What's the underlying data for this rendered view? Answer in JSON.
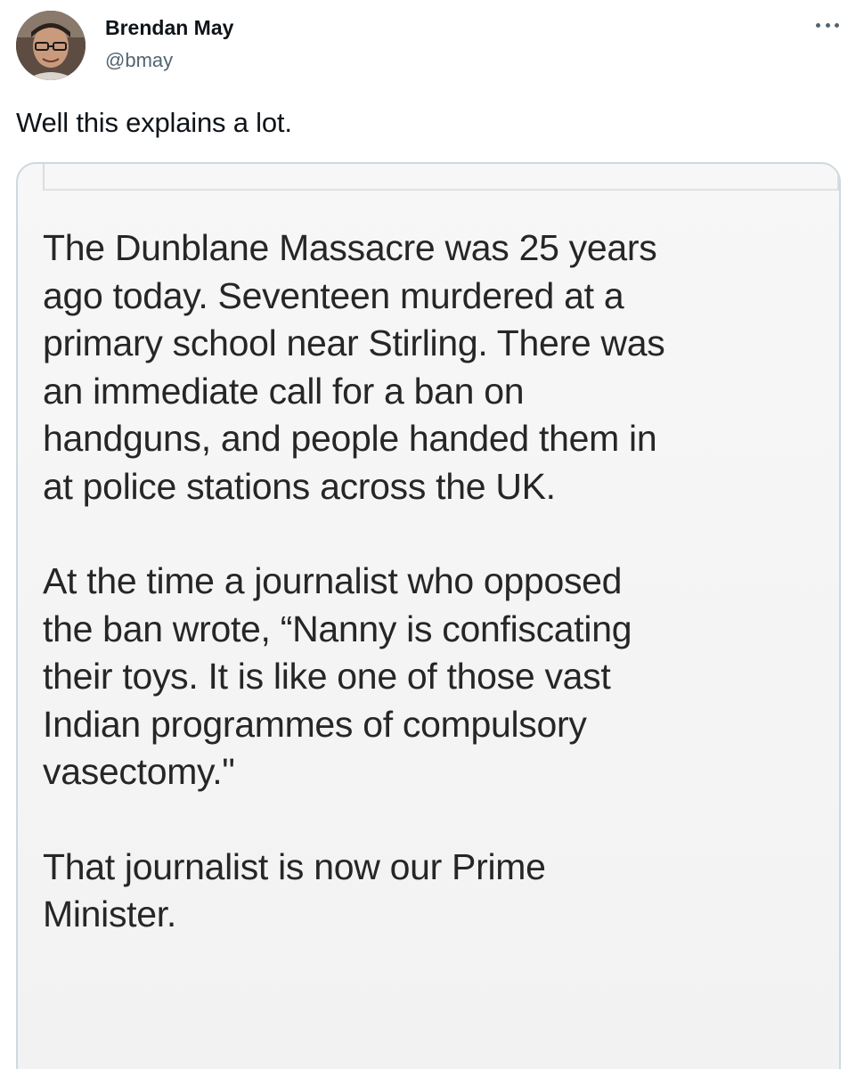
{
  "tweet": {
    "author": {
      "display_name": "Brendan May",
      "handle": "@bmay",
      "avatar_icon": "profile-photo"
    },
    "more_icon": "more-horizontal-icon",
    "text": "Well this explains a lot.",
    "media": {
      "paragraphs": [
        "The Dunblane Massacre was 25 years\nago today. Seventeen murdered at a\nprimary school near Stirling. There was\nan immediate call for a ban on\nhandguns, and people handed them in\nat police stations across the UK.",
        "At the time a journalist who opposed\nthe ban wrote, “Nanny is confiscating\ntheir toys. It is like one of those vast\nIndian programmes of compulsory\nvasectomy.\"",
        "That journalist is now our Prime\nMinister."
      ]
    }
  },
  "colors": {
    "text_primary": "#0f1419",
    "text_secondary": "#536471",
    "card_border": "#cfd9de",
    "media_text": "#262626"
  }
}
